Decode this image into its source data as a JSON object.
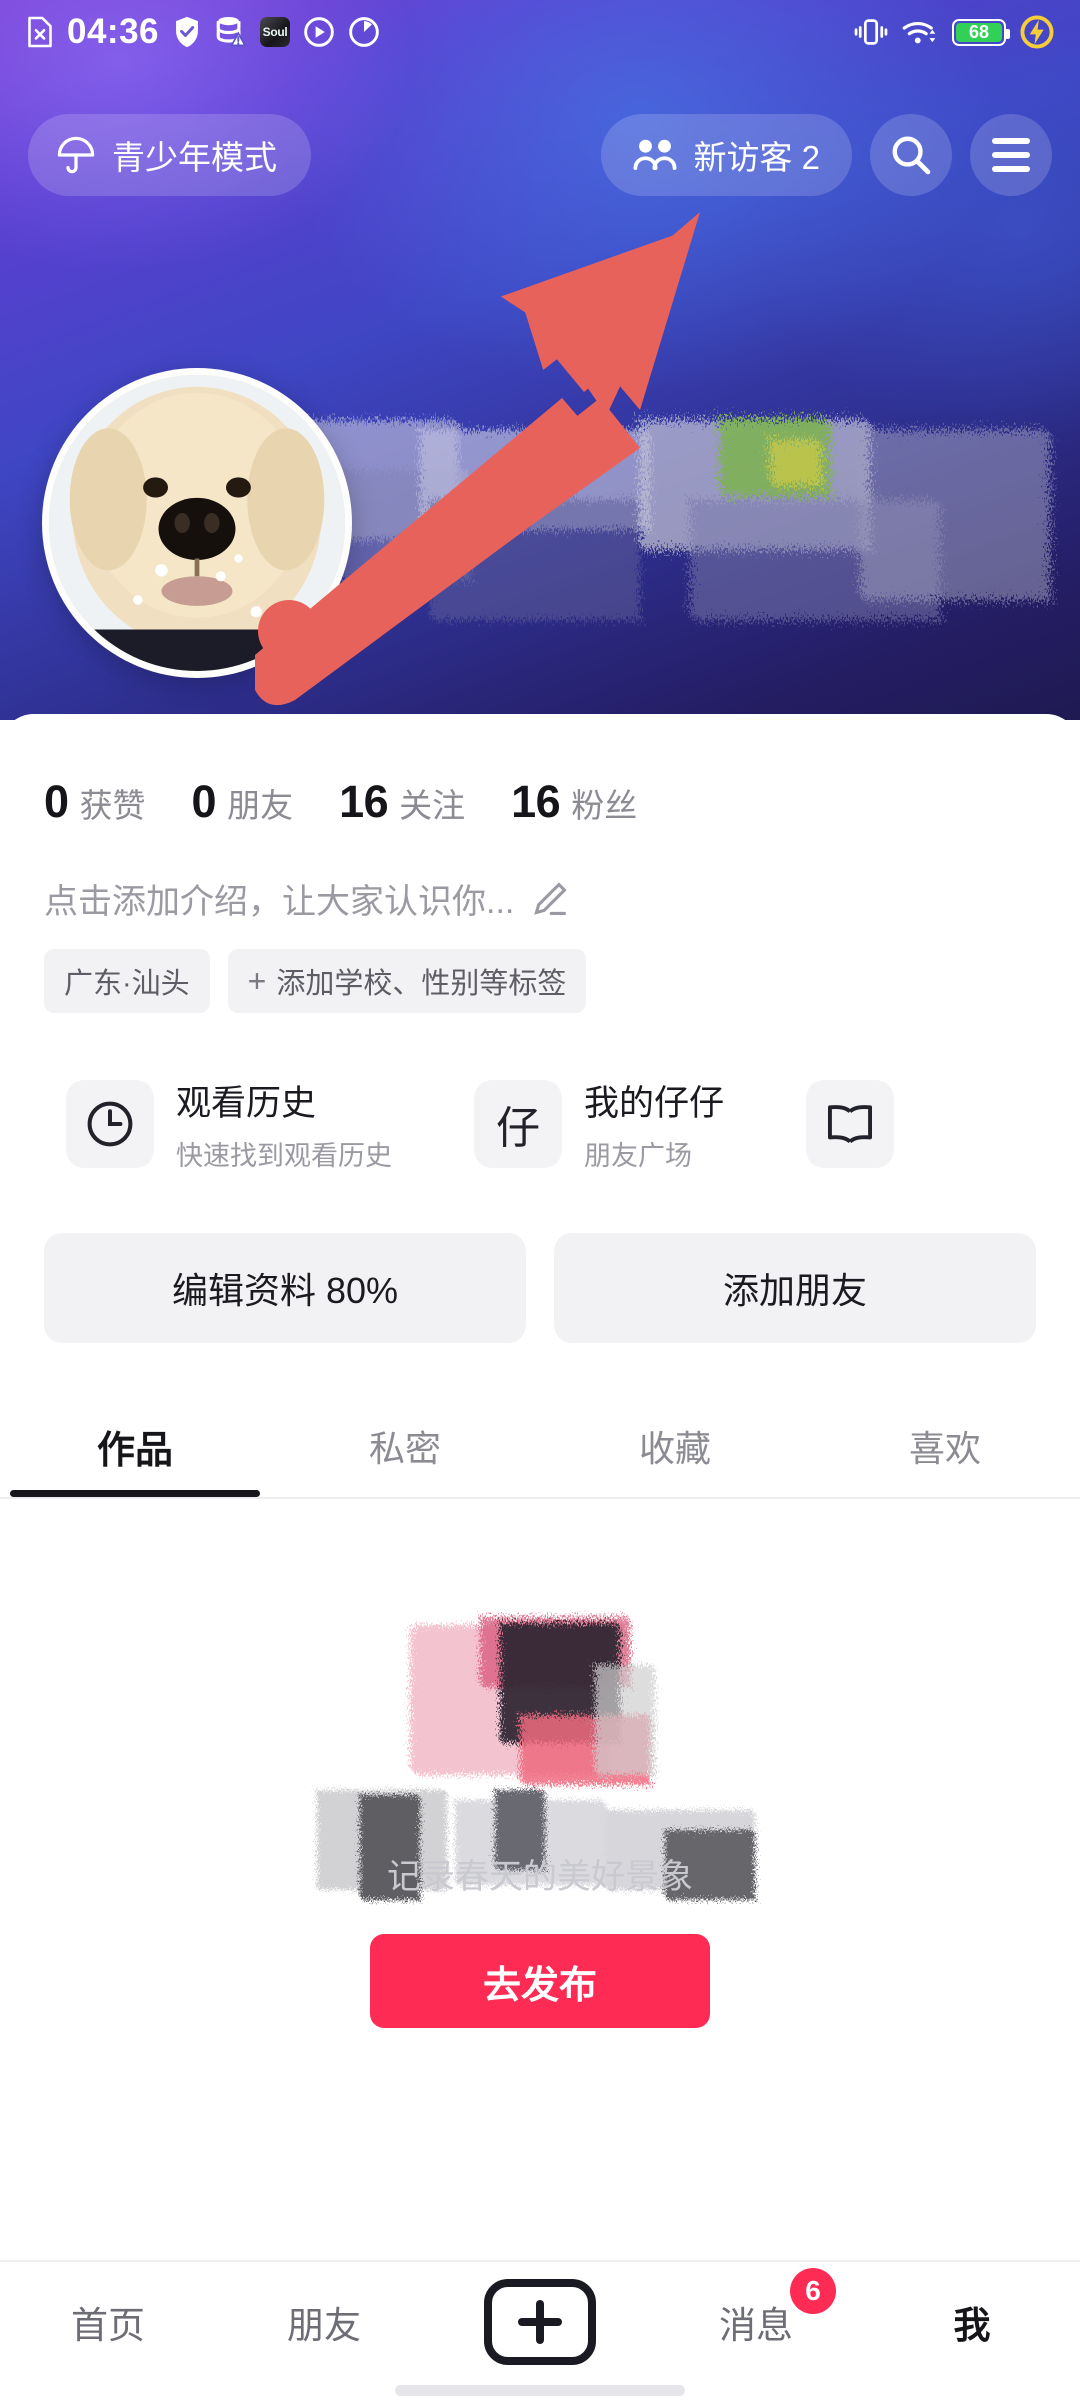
{
  "status_bar": {
    "time": "04:36",
    "left_icons": [
      "no-sim-icon",
      "shield-check-icon",
      "database-warning-icon",
      "soul-app-icon",
      "play-circle-icon",
      "speedometer-icon"
    ],
    "soul_app_label": "Soul",
    "right_icons": [
      "vibrate-icon",
      "wifi-icon",
      "battery-icon",
      "flash-charge-icon"
    ],
    "battery_level": "68"
  },
  "header": {
    "youth_mode_label": "青少年模式",
    "youth_mode_icon": "umbrella-icon",
    "visitor_label": "新访客 2",
    "visitor_icon": "two-people-icon",
    "search_icon": "search-icon",
    "menu_icon": "hamburger-menu-icon",
    "avatar_alt": "golden-retriever-puppy-avatar",
    "annotation": "red-arrow-pointing-to-visitor-button",
    "annotation_color": "#e8625c",
    "cover_gradient_from": "#7b3fd4",
    "cover_gradient_to": "#1f1a52"
  },
  "profile": {
    "stats": [
      {
        "value": "0",
        "label": "获赞"
      },
      {
        "value": "0",
        "label": "朋友"
      },
      {
        "value": "16",
        "label": "关注"
      },
      {
        "value": "16",
        "label": "粉丝"
      }
    ],
    "bio_placeholder": "点击添加介绍，让大家认识你...",
    "bio_edit_icon": "pencil-icon",
    "tags": [
      {
        "label": "广东·汕头",
        "has_plus": false
      },
      {
        "label": "添加学校、性别等标签",
        "has_plus": true
      }
    ]
  },
  "cards": [
    {
      "title": "观看历史",
      "subtitle": "快速找到观看历史",
      "icon": "clock-icon",
      "icon_glyph": "◴"
    },
    {
      "title": "我的仔仔",
      "subtitle": "朋友广场",
      "icon": "zai-character-icon",
      "icon_glyph": "仔"
    },
    {
      "title": "",
      "subtitle": "",
      "icon": "open-book-icon",
      "icon_glyph": "📖"
    }
  ],
  "actions": [
    {
      "label": "编辑资料 80%",
      "name": "edit-profile-button"
    },
    {
      "label": "添加朋友",
      "name": "add-friend-button"
    }
  ],
  "tabs": [
    {
      "label": "作品",
      "active": true
    },
    {
      "label": "私密",
      "active": false
    },
    {
      "label": "收藏",
      "active": false
    },
    {
      "label": "喜欢",
      "active": false
    }
  ],
  "empty_state": {
    "caption": "记录春天的美好景象",
    "publish_label": "去发布",
    "publish_color": "#fe2c55",
    "illustration": "pink-black-brush-strokes"
  },
  "bottom_nav": {
    "items": [
      {
        "label": "首页",
        "active": false,
        "badge": ""
      },
      {
        "label": "朋友",
        "active": false,
        "badge": ""
      },
      {
        "label": "",
        "active": false,
        "badge": "",
        "is_plus": true
      },
      {
        "label": "消息",
        "active": false,
        "badge": "6"
      },
      {
        "label": "我",
        "active": true,
        "badge": ""
      }
    ],
    "badge_color": "#fe2c55"
  }
}
